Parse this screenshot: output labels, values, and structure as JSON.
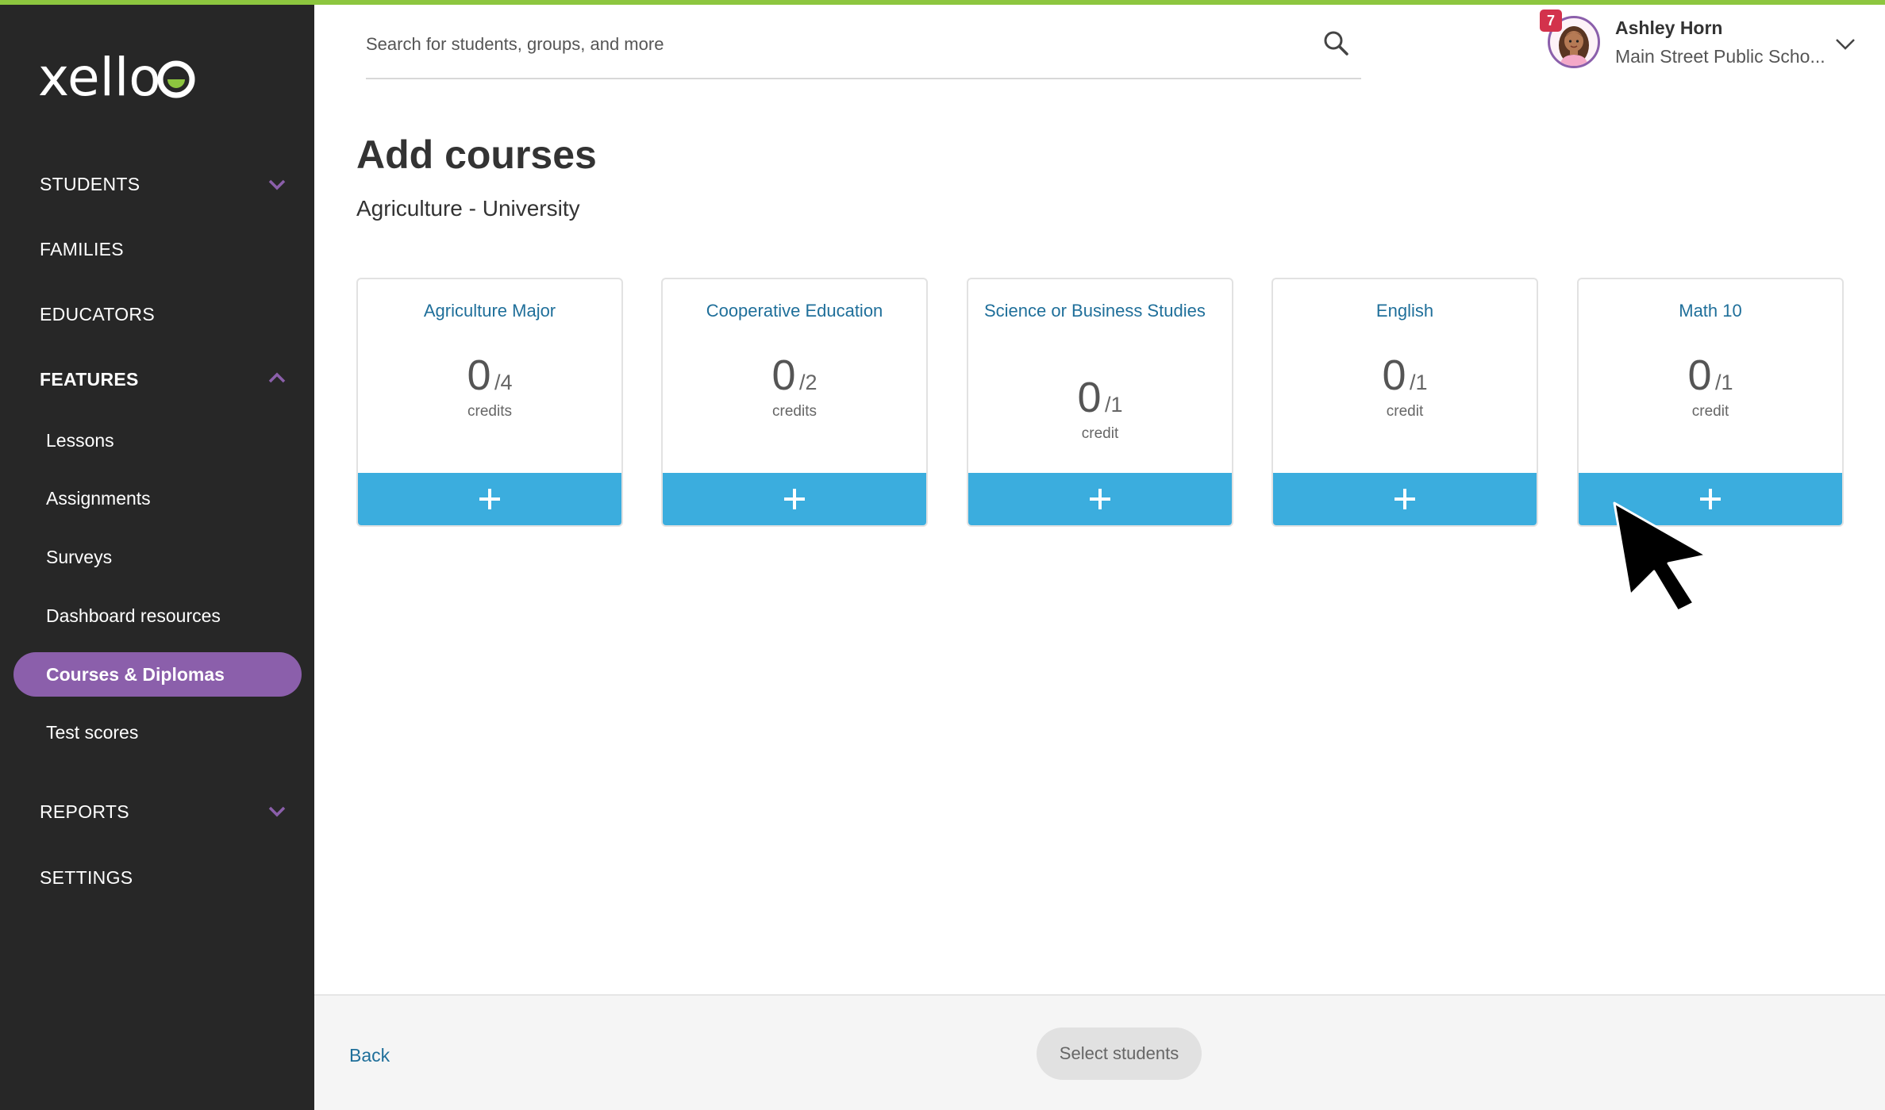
{
  "app": {
    "logo": "xello"
  },
  "colors": {
    "accent_green": "#8dc63f",
    "sidebar_bg": "#272727",
    "active_purple": "#8b5fab",
    "add_blue": "#3badde",
    "link_blue": "#1f6f9a",
    "badge_red": "#d3324c"
  },
  "sidebar": {
    "sections": {
      "students": "STUDENTS",
      "families": "FAMILIES",
      "educators": "EDUCATORS",
      "features": "FEATURES",
      "reports": "REPORTS",
      "settings": "SETTINGS"
    },
    "features_items": [
      {
        "label": "Lessons"
      },
      {
        "label": "Assignments"
      },
      {
        "label": "Surveys"
      },
      {
        "label": "Dashboard resources"
      },
      {
        "label": "Courses & Diplomas",
        "active": true
      },
      {
        "label": "Test scores"
      }
    ]
  },
  "header": {
    "search_placeholder": "Search for students, groups, and more",
    "search_icon": "search-icon",
    "user": {
      "name": "Ashley Horn",
      "school": "Main Street Public Scho...",
      "notifications": "7"
    }
  },
  "main": {
    "title": "Add courses",
    "subtitle": "Agriculture - University",
    "cards": [
      {
        "title": "Agriculture Major",
        "count": "0",
        "total": "/4",
        "unit": "credits"
      },
      {
        "title": "Cooperative Education",
        "count": "0",
        "total": "/2",
        "unit": "credits"
      },
      {
        "title": "Science or Business Studies",
        "count": "0",
        "total": "/1",
        "unit": "credit"
      },
      {
        "title": "English",
        "count": "0",
        "total": "/1",
        "unit": "credit"
      },
      {
        "title": "Math 10",
        "count": "0",
        "total": "/1",
        "unit": "credit"
      }
    ]
  },
  "footer": {
    "back": "Back",
    "select_students": "Select students"
  }
}
